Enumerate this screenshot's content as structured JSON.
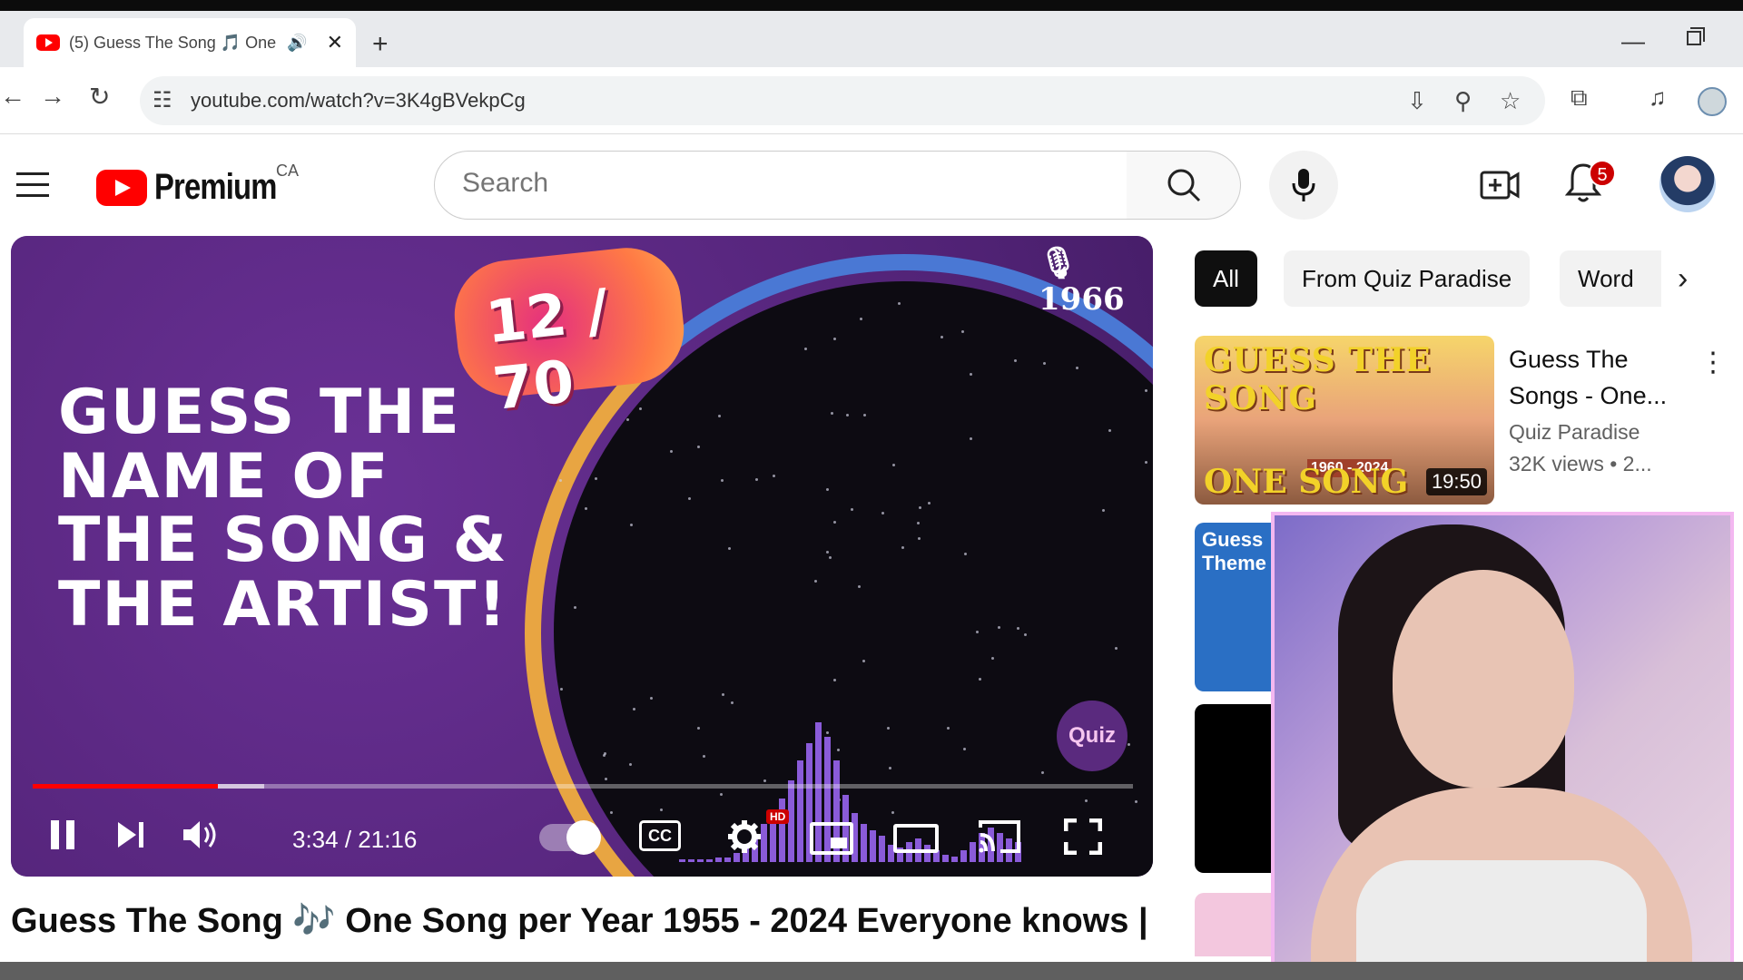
{
  "browser": {
    "tab_title": "(5) Guess The Song 🎵 One",
    "tab_close": "✕",
    "new_tab": "+",
    "url": "youtube.com/watch?v=3K4gBVekpCg"
  },
  "header": {
    "logo_text": "Premium",
    "country": "CA",
    "search_placeholder": "Search",
    "notification_count": "5"
  },
  "player": {
    "counter": "12 / 70",
    "year": "🎙 1966",
    "headline": "GUESS THE NAME OF THE SONG & THE ARTIST!",
    "quiz_badge": "Quiz",
    "time": "3:34 / 21:16",
    "progress_played": 0.168,
    "progress_buffered": 0.21,
    "cc_label": "CC",
    "hd_label": "HD",
    "bar_levels": [
      2,
      2,
      2,
      2,
      3,
      3,
      6,
      12,
      18,
      26,
      34,
      44,
      56,
      70,
      82,
      96,
      86,
      70,
      46,
      34,
      26,
      22,
      18,
      12,
      10,
      14,
      16,
      12,
      8,
      5,
      4,
      8,
      14,
      20,
      24,
      20,
      16,
      14
    ],
    "colors": {
      "accent": "#ff0000",
      "bars": "#8a5bd9"
    }
  },
  "video_title": "Guess The Song 🎶 One Song per Year 1955 - 2024 Everyone knows |",
  "chips": [
    "All",
    "From Quiz Paradise",
    "Word"
  ],
  "recommended": {
    "thumb_line1": "GUESS THE SONG",
    "thumb_line2": "ONE SONG PER YEAR",
    "thumb_years": "1960 - 2024",
    "duration": "19:50",
    "title": "Guess The Songs - One...",
    "channel": "Quiz Paradise",
    "views": "32K views • 2...",
    "thumb2_text": "Guess Theme"
  }
}
